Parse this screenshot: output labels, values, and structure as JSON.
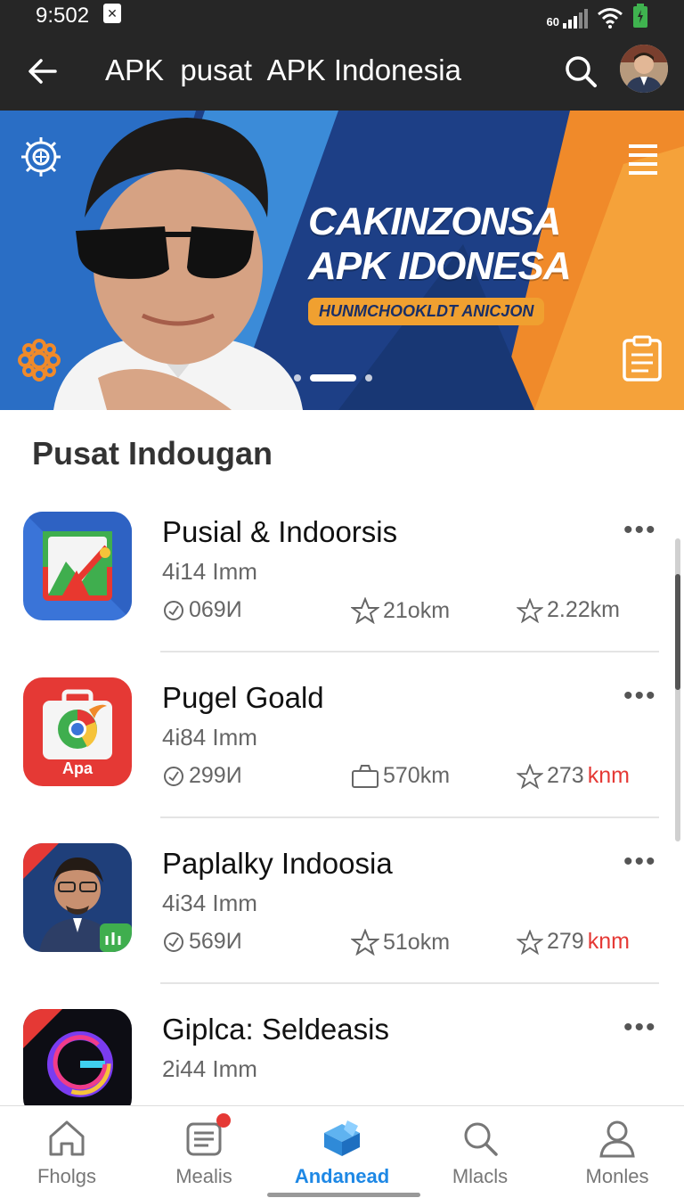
{
  "status": {
    "time": "9:502",
    "network": "60"
  },
  "appbar": {
    "title": "APK  pusat  APK Indonesia"
  },
  "banner": {
    "headline_line1": "CAKINZONSA",
    "headline_line2": "APK IDONESA",
    "pill": "HUNMCHOOKLDT ANICJON",
    "active_slide": 2,
    "slides": 3
  },
  "section": {
    "title": "Pusat Indougan"
  },
  "apps": [
    {
      "name": "Pusial & Indoorsis",
      "size": "4i14 Imm",
      "stat1": "069И",
      "stat2": "21okm",
      "stat3": "2.22km",
      "stat3_red": "",
      "stat2_icon": "star-icon"
    },
    {
      "name": "Pugel Goald",
      "size": "4i84 Imm",
      "stat1": "299И",
      "stat2": "570km",
      "stat3": "273",
      "stat3_red": "knm",
      "stat2_icon": "box-icon"
    },
    {
      "name": "Paplalky Indoosia",
      "size": "4i34 Imm",
      "stat1": "569И",
      "stat2": "51okm",
      "stat3": "279",
      "stat3_red": "knm",
      "stat2_icon": "star-icon"
    },
    {
      "name": "Giplca: Seldeasis",
      "size": "2i44 Imm",
      "stat1": "",
      "stat2": "",
      "stat3": "",
      "stat3_red": "",
      "stat2_icon": "box-icon"
    }
  ],
  "icon_badge_text": "Apa",
  "nav": [
    {
      "label": "Fholgs",
      "icon": "home-icon"
    },
    {
      "label": "Mealis",
      "icon": "news-icon"
    },
    {
      "label": "Andanead",
      "icon": "apps-icon"
    },
    {
      "label": "Mlacls",
      "icon": "search-icon"
    },
    {
      "label": "Monles",
      "icon": "profile-icon"
    }
  ],
  "colors": {
    "accent": "#1e88e5",
    "appbar": "#262626",
    "banner_blue": "#1d3f86",
    "banner_orange": "#f0a030",
    "red": "#e53935"
  }
}
